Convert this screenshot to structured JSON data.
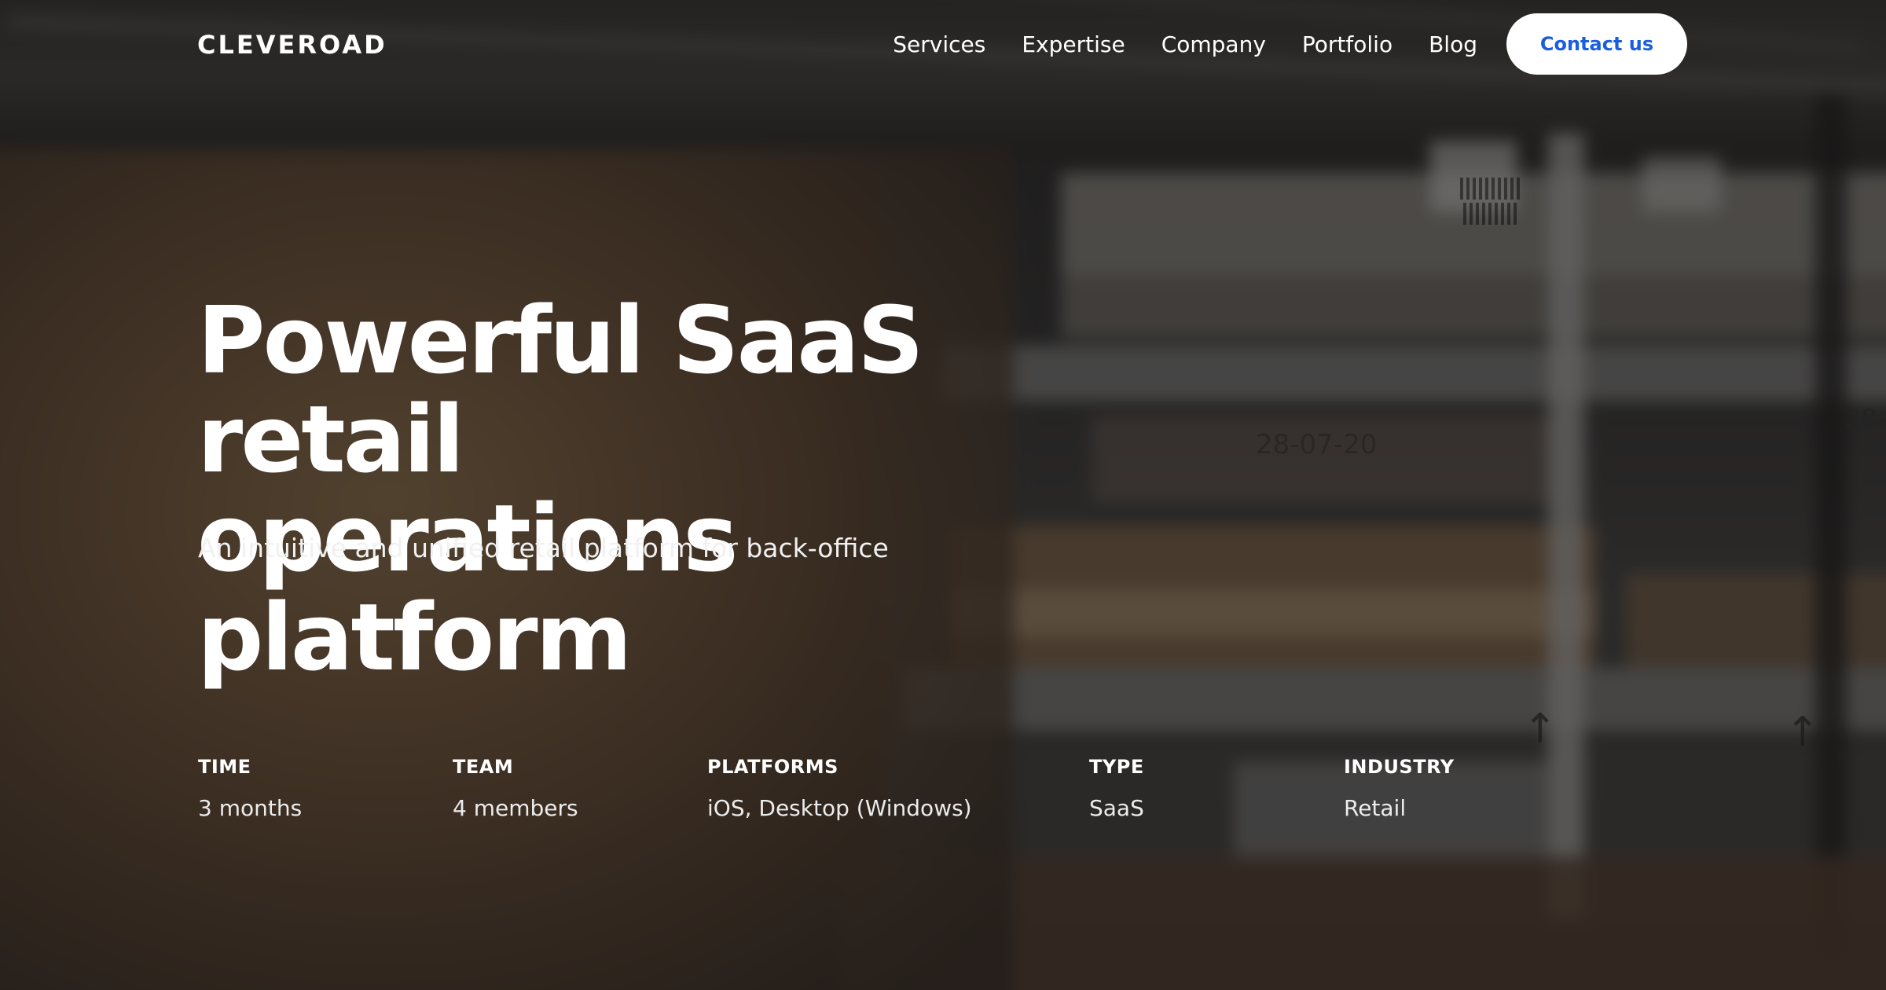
{
  "header": {
    "logo": "CLEVEROAD",
    "nav": [
      "Services",
      "Expertise",
      "Company",
      "Portfolio",
      "Blog"
    ],
    "contact_label": "Contact us"
  },
  "hero": {
    "title_line1": "Powerful SaaS retail",
    "title_line2": "operations platform",
    "subtitle": "An intuitive and unified retail platform for back-office"
  },
  "background": {
    "shelf_labels": [
      "28-07-20",
      "28-"
    ]
  },
  "facts": [
    {
      "label": "TIME",
      "value": "3 months"
    },
    {
      "label": "TEAM",
      "value": "4 members"
    },
    {
      "label": "PLATFORMS",
      "value": "iOS, Desktop (Windows)"
    },
    {
      "label": "TYPE",
      "value": "SaaS"
    },
    {
      "label": "INDUSTRY",
      "value": "Retail"
    }
  ],
  "colors": {
    "contact_text": "#1a5ee0",
    "contact_bg": "#ffffff",
    "text": "#ffffff"
  }
}
